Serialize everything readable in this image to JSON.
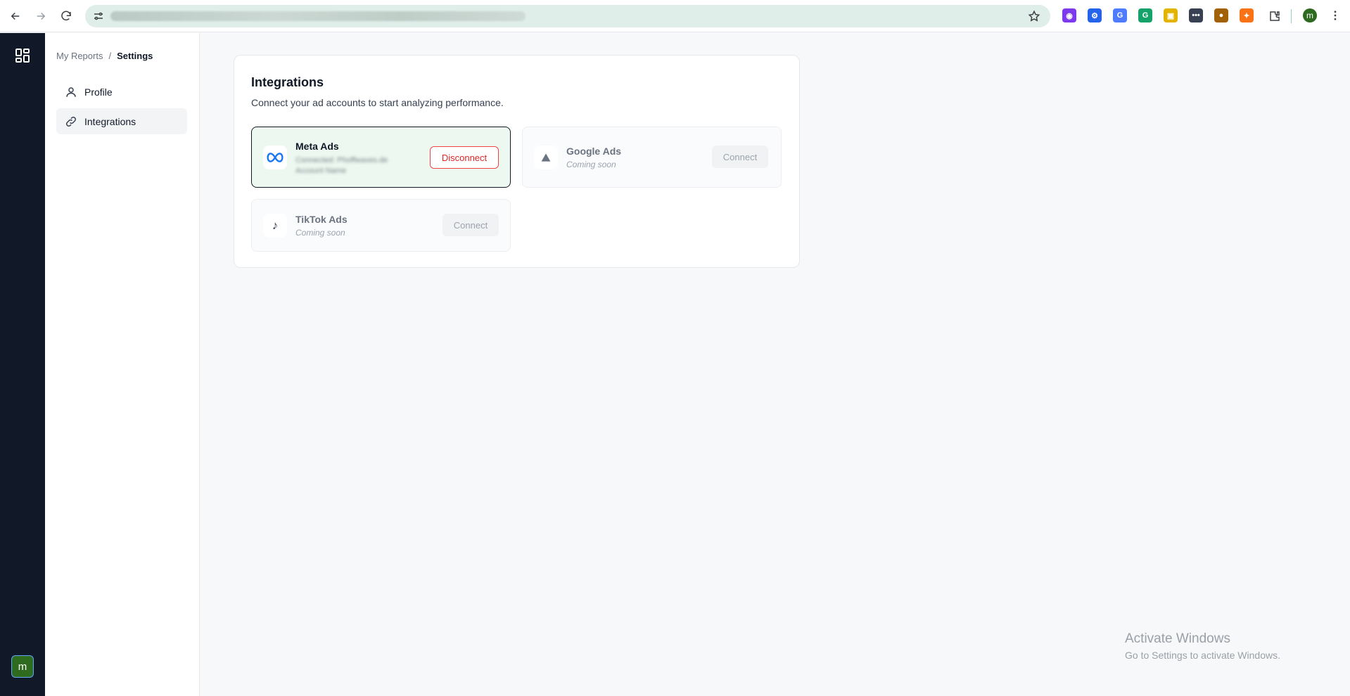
{
  "browser": {
    "icons": [
      "back-arrow-icon",
      "forward-arrow-icon",
      "reload-icon",
      "site-settings-icon",
      "bookmark-star-icon",
      "extensions-icon",
      "chrome-menu-icon"
    ],
    "profile_initial": "m",
    "extensions": [
      {
        "name": "color-picker-extension-icon",
        "color": "#7c3aed",
        "glyph": "◉"
      },
      {
        "name": "gear-extension-icon",
        "color": "#2563eb",
        "glyph": "⚙"
      },
      {
        "name": "translate-extension-icon",
        "color": "#4f7cff",
        "glyph": "G"
      },
      {
        "name": "grammarly-extension-icon",
        "color": "#15a36b",
        "glyph": "G"
      },
      {
        "name": "screenshot-extension-icon",
        "color": "#e2b400",
        "glyph": "▣"
      },
      {
        "name": "password-extension-icon",
        "color": "#374151",
        "glyph": "•••"
      },
      {
        "name": "cookie-extension-icon",
        "color": "#a16207",
        "glyph": "●"
      },
      {
        "name": "clicker-extension-icon",
        "color": "#f97316",
        "glyph": "✦"
      }
    ]
  },
  "rail": {
    "avatar_initial": "m"
  },
  "breadcrumb": {
    "parent": "My Reports",
    "separator": "/",
    "current": "Settings"
  },
  "sidebar": {
    "items": [
      {
        "label": "Profile",
        "icon": "user-icon",
        "active": false
      },
      {
        "label": "Integrations",
        "icon": "link-icon",
        "active": true
      }
    ]
  },
  "integrations": {
    "title": "Integrations",
    "subtitle": "Connect your ad accounts to start analyzing performance.",
    "cards": [
      {
        "name": "Meta Ads",
        "status": "connected",
        "account_blurred": "Connected: Phoffwaves.de Account Name",
        "action": "Disconnect",
        "icon": "meta-infinity-icon"
      },
      {
        "name": "Google Ads",
        "status": "Coming soon",
        "action": "Connect",
        "icon": "triangle-icon"
      },
      {
        "name": "TikTok Ads",
        "status": "Coming soon",
        "action": "Connect",
        "icon": "music-note-icon"
      }
    ]
  },
  "watermark": {
    "title": "Activate Windows",
    "subtitle": "Go to Settings to activate Windows."
  },
  "colors": {
    "rail": "#111827",
    "connected_bg": "#edf9f0",
    "disconnect": "#dc2626"
  }
}
